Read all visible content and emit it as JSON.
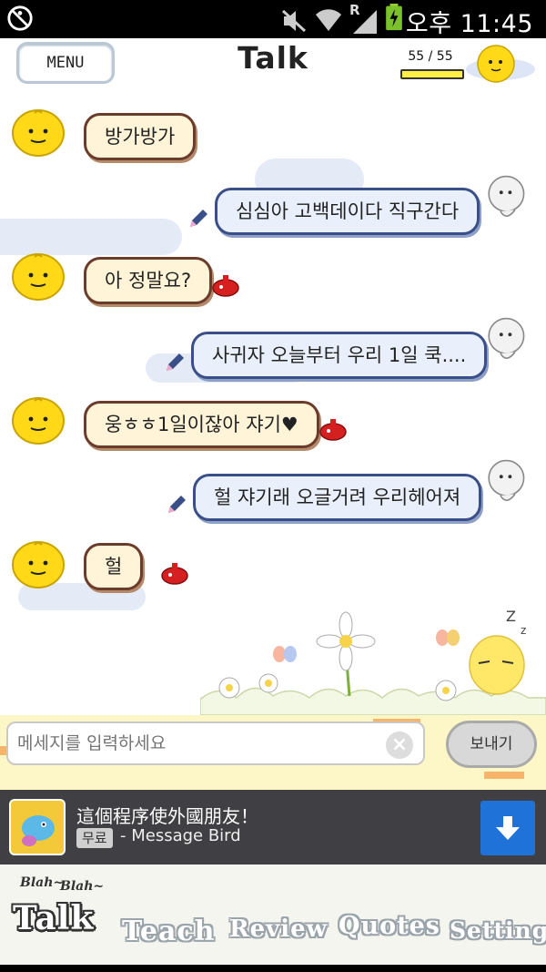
{
  "status_bar": {
    "time": "오후 11:45",
    "signal_label": "R"
  },
  "header": {
    "menu_label": "MENU",
    "title": "Talk",
    "counter": "55 / 55",
    "energy_level": 1.0
  },
  "messages": [
    {
      "from": "simsimi",
      "text": "방가방가"
    },
    {
      "from": "user",
      "text": "심심아 고백데이다 직구간다"
    },
    {
      "from": "simsimi",
      "text": "아 정말요?"
    },
    {
      "from": "user",
      "text": "사귀자 오늘부터 우리 1일 쿡...."
    },
    {
      "from": "simsimi",
      "text": "웅ㅎㅎ1일이잖아 쟈기♥"
    },
    {
      "from": "user",
      "text": "헐 쟈기래 오글거려 우리헤어져"
    },
    {
      "from": "simsimi",
      "text": "헐"
    }
  ],
  "composer": {
    "placeholder": "메세지를 입력하세요",
    "send_label": "보내기"
  },
  "ad": {
    "title": "這個程序使外國朋友！",
    "tag": "무료",
    "subtitle": "- Message Bird"
  },
  "nav": {
    "blah1": "Blah~",
    "blah2": "Blah~",
    "items": [
      "Talk",
      "Teach",
      "Review",
      "Quotes",
      "Setting"
    ]
  },
  "colors": {
    "sim_bubble_border": "#6b3b2b",
    "user_bubble_border": "#3a4f88",
    "ad_button": "#1f73d8",
    "composer_bg": "#fdf7c8"
  }
}
